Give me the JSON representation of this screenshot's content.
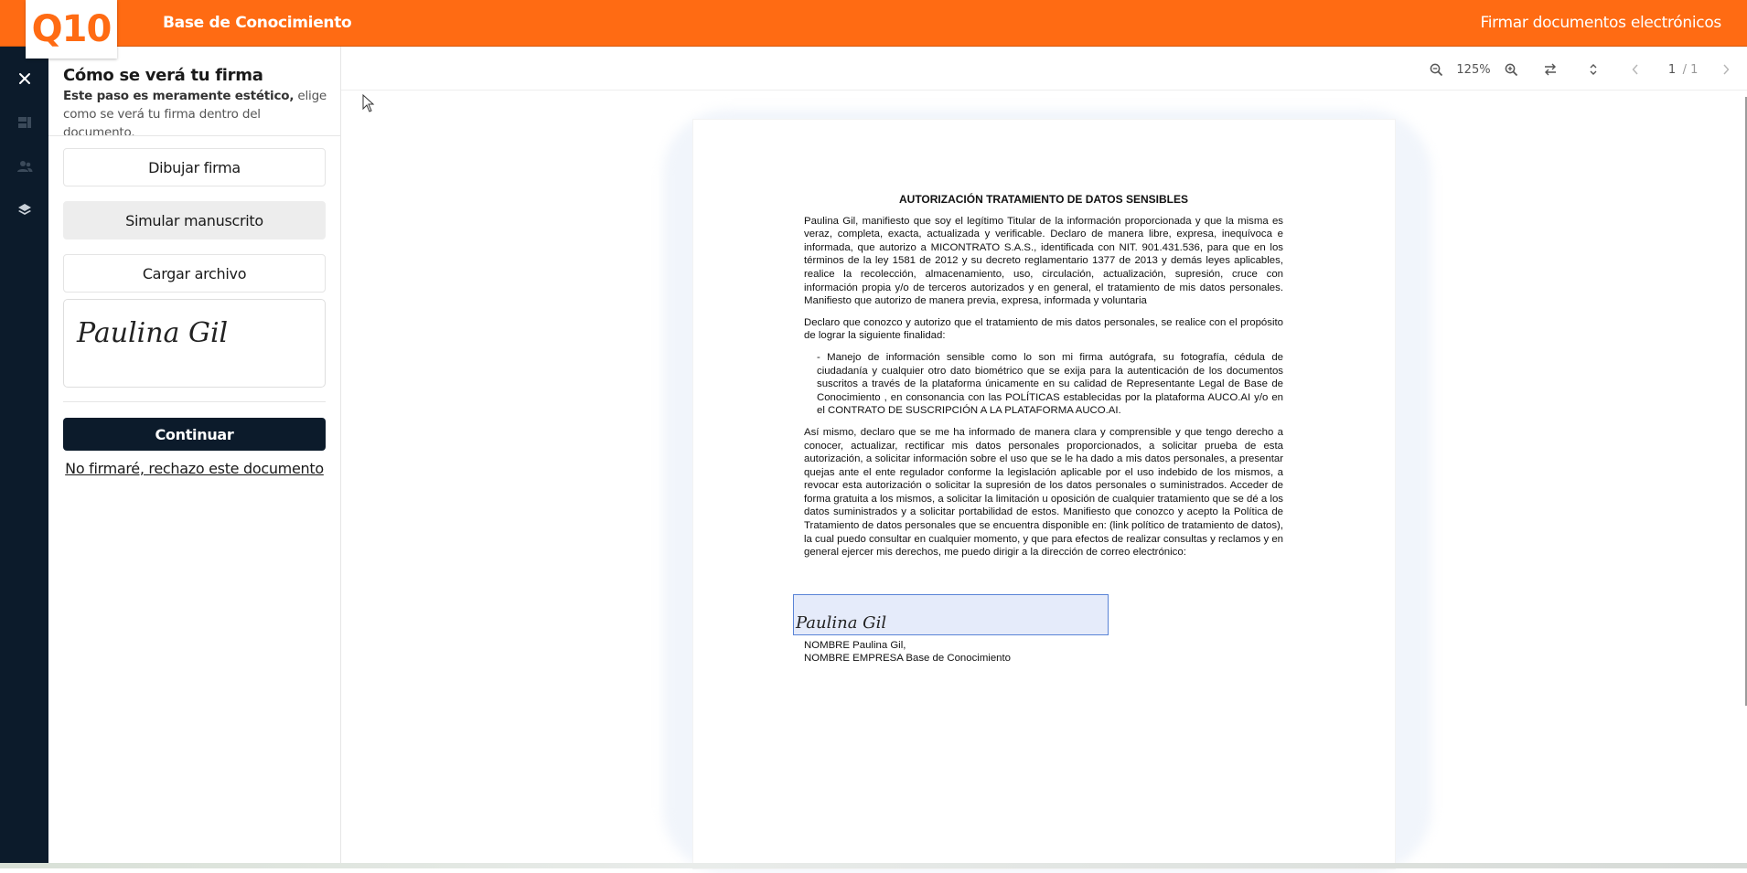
{
  "header": {
    "logo": "Q10",
    "title": "Base de Conocimiento",
    "right_text": "Firmar documentos electrónicos"
  },
  "rail": {
    "icons": [
      "close-icon",
      "dashboard-icon",
      "users-icon",
      "layers-icon"
    ]
  },
  "panel": {
    "title": "Cómo se verá tu firma",
    "subtitle_bold": "Este paso es meramente estético,",
    "subtitle_rest": " elige como se verá tu firma dentro del documento.",
    "options": [
      {
        "label": "Dibujar firma",
        "selected": false
      },
      {
        "label": "Simular manuscrito",
        "selected": true
      },
      {
        "label": "Cargar archivo",
        "selected": false
      }
    ],
    "signature_preview": "Paulina Gil",
    "continue_label": "Continuar",
    "reject_label": "No firmaré, rechazo este documento"
  },
  "toolbar": {
    "zoom": "125%",
    "page_current": "1",
    "page_sep": "/",
    "page_total": "1"
  },
  "document": {
    "title": "AUTORIZACIÓN TRATAMIENTO DE DATOS SENSIBLES",
    "p1": "Paulina Gil, manifiesto que soy el legítimo Titular de la información proporcionada y que la misma es veraz, completa, exacta, actualizada y verificable. Declaro de manera libre, expresa, inequívoca e informada, que autorizo a MICONTRATO S.A.S., identificada con NIT. 901.431.536, para que en los términos de la ley 1581 de 2012 y su decreto reglamentario 1377 de 2013 y demás leyes aplicables, realice la recolección, almacenamiento, uso, circulación, actualización, supresión, cruce con información propia y/o de terceros autorizados y en general, el tratamiento de mis datos personales. Manifiesto que autorizo de manera previa, expresa, informada y voluntaria",
    "p2": "Declaro que conozco y autorizo que el tratamiento de mis datos personales, se realice con el propósito de lograr la siguiente finalidad:",
    "bullet": "- Manejo de información sensible como lo son mi firma autógrafa, su fotografía, cédula de ciudadanía y cualquier otro dato biométrico que se exija para la autenticación de los documentos suscritos a través de la plataforma únicamente en su calidad de Representante Legal de Base de Conocimiento , en consonancia con las POLÍTICAS establecidas por la plataforma AUCO.AI y/o en el CONTRATO DE SUSCRIPCIÓN A LA PLATAFORMA AUCO.AI.",
    "p3": "Así mismo, declaro que se me ha informado de manera clara y comprensible y que tengo derecho a conocer, actualizar, rectificar mis datos personales proporcionados, a solicitar prueba de esta autorización, a solicitar información sobre el uso que se le ha dado a mis datos personales, a presentar quejas ante el ente regulador conforme la legislación aplicable por el uso indebido de los mismos, a revocar esta autorización o solicitar la supresión de los datos personales o suministrados. Acceder de forma gratuita a los mismos, a solicitar la limitación u oposición de cualquier tratamiento que se dé a los datos suministrados y a solicitar portabilidad de estos. Manifiesto que conozco y acepto la Política de Tratamiento de datos personales que se encuentra disponible en: (link político de tratamiento de datos), la cual puedo consultar en cualquier momento, y que para efectos de realizar consultas y reclamos y en general ejercer mis derechos, me puedo dirigir a la dirección de correo electrónico:",
    "signature": "Paulina Gil",
    "name_line": "NOMBRE Paulina Gil,",
    "company_line": "NOMBRE EMPRESA Base de Conocimiento"
  },
  "colors": {
    "brand_orange": "#ff6b13",
    "rail_dark": "#0c1b2b",
    "signature_field": "#e5ebfa"
  }
}
